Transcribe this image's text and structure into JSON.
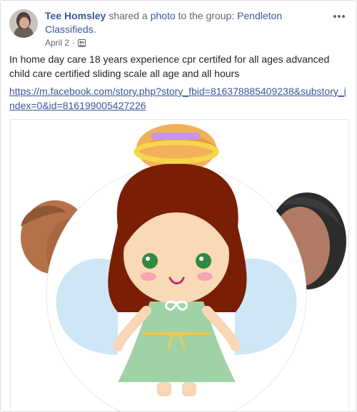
{
  "post": {
    "author": "Tee Homsley",
    "action_text": " shared a ",
    "object_text": "photo",
    "to_text": " to the group: ",
    "group_name": "Pendleton Classifieds",
    "group_suffix": ".",
    "date": "April 2",
    "date_separator": "·",
    "privacy_icon": "group-members-icon",
    "more_icon": "more-options-icon",
    "body": "In home day care 18 years experience cpr certifed for all ages advanced child care certified sliding scale all age and all hours",
    "link": "https://m.facebook.com/story.php?story_fbid=816378885409238&substory_index=0&id=816199005427226"
  },
  "photo": {
    "icon": "angel-girl-illustration"
  },
  "colors": {
    "link": "#385898",
    "meta": "#606770",
    "text": "#1d2129",
    "angel_hair": "#7b1e06",
    "angel_dress": "#9fd3a7",
    "angel_wings": "#cfe6f6",
    "halo": "#f6d64a"
  }
}
